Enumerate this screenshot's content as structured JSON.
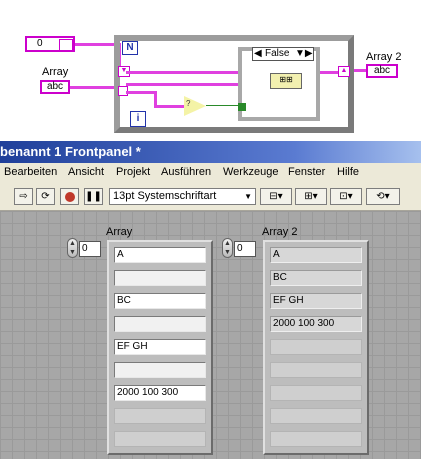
{
  "diagram": {
    "numeric_control_value": "0",
    "array_control_label": "Array",
    "array_control_type": "abc",
    "array_indicator_label": "Array 2",
    "array_indicator_type": "abc",
    "loop_count_terminal": "N",
    "loop_iteration_terminal": "i",
    "case_selector_value": "False"
  },
  "window": {
    "title": "benannt 1 Frontpanel *",
    "menu": [
      "Bearbeiten",
      "Ansicht",
      "Projekt",
      "Ausführen",
      "Werkzeuge",
      "Fenster",
      "Hilfe"
    ],
    "font_selector": "13pt Systemschriftart"
  },
  "panel": {
    "array1": {
      "label": "Array",
      "index": "0",
      "elements": [
        "A",
        "",
        "BC",
        "",
        "EF GH",
        "",
        "2000 100 300",
        "",
        ""
      ]
    },
    "array2": {
      "label": "Array 2",
      "index": "0",
      "elements": [
        "A",
        "BC",
        "EF GH",
        "2000 100 300",
        "",
        "",
        "",
        "",
        ""
      ]
    }
  },
  "colors": {
    "string_wire": "#e040e0",
    "boolean_wire": "#2a8a2a",
    "titlebar": "#1f3f9a",
    "panel_bg": "#a7a7a7"
  }
}
